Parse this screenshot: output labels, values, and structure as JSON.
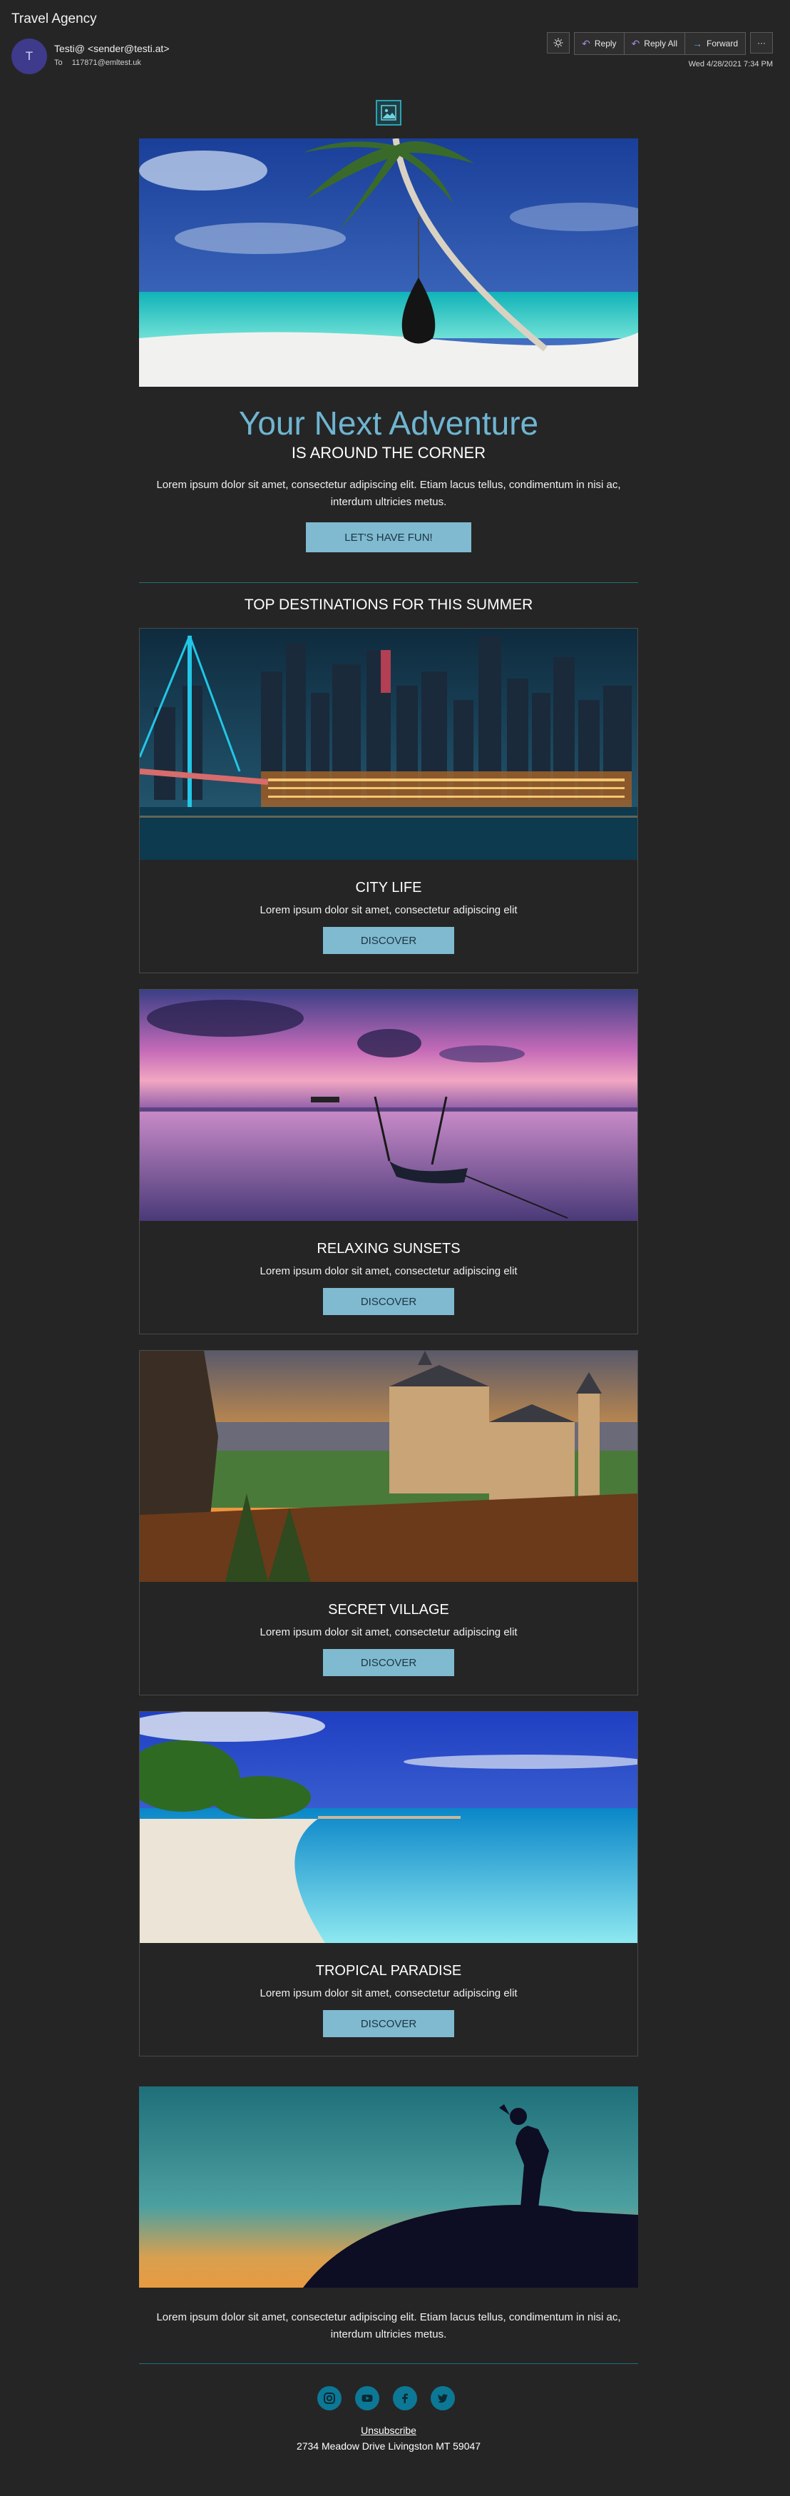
{
  "mail": {
    "subject": "Travel Agency",
    "avatar_initial": "T",
    "sender": "Testi@ <sender@testi.at>",
    "to_label": "To",
    "recipient": "117871@emltest.uk",
    "date": "Wed 4/28/2021 7:34 PM",
    "toolbar": {
      "reply": "Reply",
      "reply_all": "Reply All",
      "forward": "Forward",
      "more": "···"
    }
  },
  "email": {
    "hero": {
      "title": "Your Next Adventure",
      "subtitle": "IS AROUND THE CORNER",
      "text": "Lorem ipsum dolor sit amet, consectetur adipiscing elit. Etiam lacus tellus, condimentum in nisi ac, interdum ultricies metus.",
      "cta": "LET'S HAVE FUN!"
    },
    "section_title": "TOP DESTINATIONS FOR THIS SUMMER",
    "destinations": [
      {
        "title": "CITY LIFE",
        "text": "Lorem ipsum dolor sit amet, consectetur adipiscing elit",
        "button": "DISCOVER"
      },
      {
        "title": "RELAXING SUNSETS",
        "text": "Lorem ipsum dolor sit amet, consectetur adipiscing elit",
        "button": "DISCOVER"
      },
      {
        "title": "SECRET VILLAGE",
        "text": "Lorem ipsum dolor sit amet, consectetur adipiscing elit",
        "button": "DISCOVER"
      },
      {
        "title": "TROPICAL PARADISE",
        "text": "Lorem ipsum dolor sit amet, consectetur adipiscing elit",
        "button": "DISCOVER"
      }
    ],
    "footer": {
      "text": "Lorem ipsum dolor sit amet, consectetur adipiscing elit. Etiam lacus tellus, condimentum in nisi ac, interdum ultricies metus.",
      "socials": [
        "instagram-icon",
        "youtube-icon",
        "facebook-icon",
        "twitter-icon"
      ],
      "unsubscribe": "Unsubscribe",
      "address": "2734 Meadow Drive Livingston MT 59047"
    }
  },
  "colors": {
    "background": "#252525",
    "accent": "#7fbad0",
    "title": "#6fb5d1",
    "social": "#0c7896",
    "rule": "#1f6f78"
  }
}
